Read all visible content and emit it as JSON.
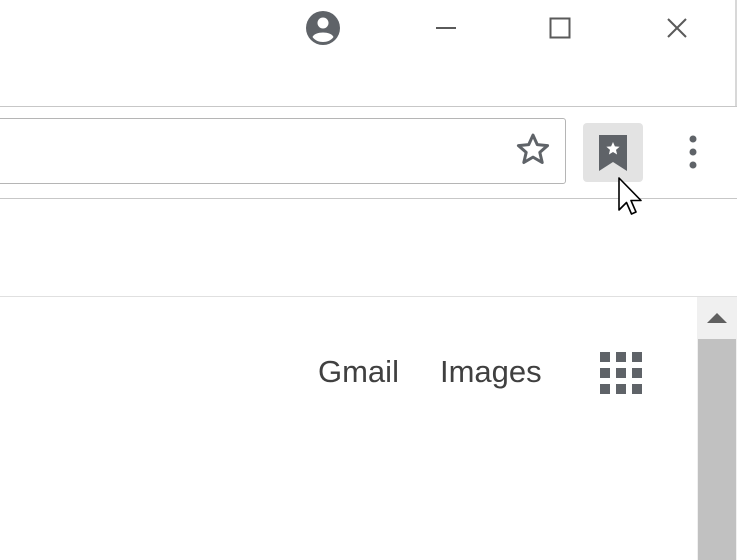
{
  "window": {
    "controls": [
      "profile",
      "minimize",
      "maximize",
      "close"
    ]
  },
  "toolbar": {
    "bookmark_star_icon": "star-outline-icon",
    "extension_icon": "bookmark-star-icon",
    "menu_icon": "vertical-dots-icon"
  },
  "page": {
    "links": {
      "gmail": "Gmail",
      "images": "Images"
    },
    "apps_icon": "apps-grid-icon"
  },
  "colors": {
    "icon_gray": "#5f6368",
    "extension_bg": "#e3e3e3",
    "link_text": "#404040",
    "scrollbar_thumb": "#c1c1c1",
    "scrollbar_track": "#f0f0f0"
  }
}
